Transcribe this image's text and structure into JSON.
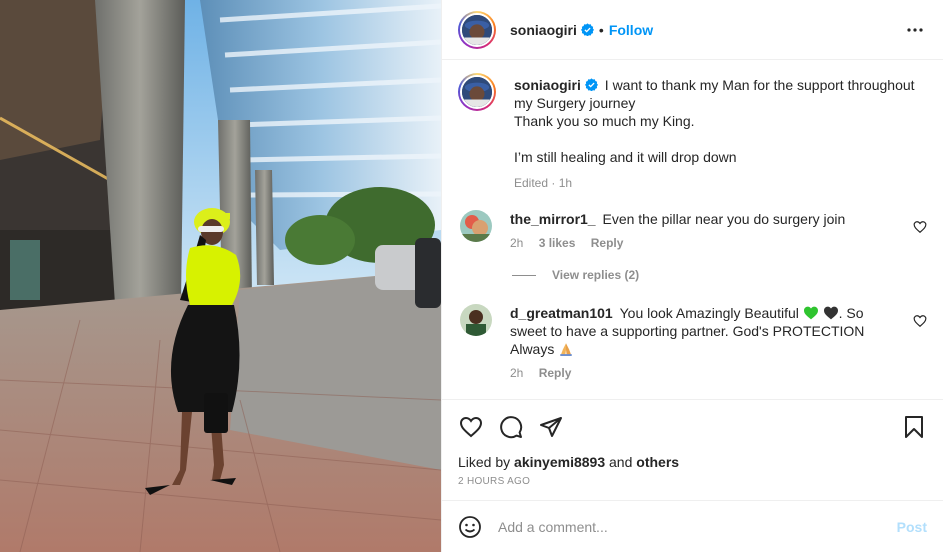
{
  "post_author": {
    "username": "soniaogiri",
    "verified": true,
    "follow_label": "Follow",
    "separator": "•"
  },
  "caption": {
    "username": "soniaogiri",
    "lines": [
      "I want to thank my Man for the support throughout",
      "my Surgery journey",
      "Thank you so much my King.",
      "",
      "I’m still healing and it will drop down"
    ],
    "meta": "Edited · 1h"
  },
  "comments": [
    {
      "username": "the_mirror1_",
      "text": "Even the pillar near you do surgery join",
      "time": "2h",
      "likes": "3 likes",
      "reply_label": "Reply",
      "view_replies": "View replies (2)"
    },
    {
      "username": "d_greatman101",
      "text_part1": "You look Amazingly Beautiful",
      "text_part2": ". So sweet to have a supporting partner. God's PROTECTION Always",
      "emojis": [
        "green-heart",
        "black-heart",
        "folded-hands"
      ],
      "time": "2h",
      "reply_label": "Reply"
    }
  ],
  "actions": {
    "icons": [
      "heart-icon",
      "comment-icon",
      "share-icon",
      "bookmark-icon"
    ],
    "liked_by_prefix": "Liked by",
    "liked_by_user": "akinyemi8893",
    "liked_by_suffix_and": "and",
    "liked_by_others": "others",
    "timestamp": "2 HOURS AGO"
  },
  "add_comment": {
    "placeholder": "Add a comment...",
    "post_label": "Post"
  },
  "colors": {
    "link_blue": "#0095f6",
    "post_disabled": "#b2dffc",
    "secondary_text": "#8e8e8e",
    "outfit_neon": "#d7f200"
  }
}
